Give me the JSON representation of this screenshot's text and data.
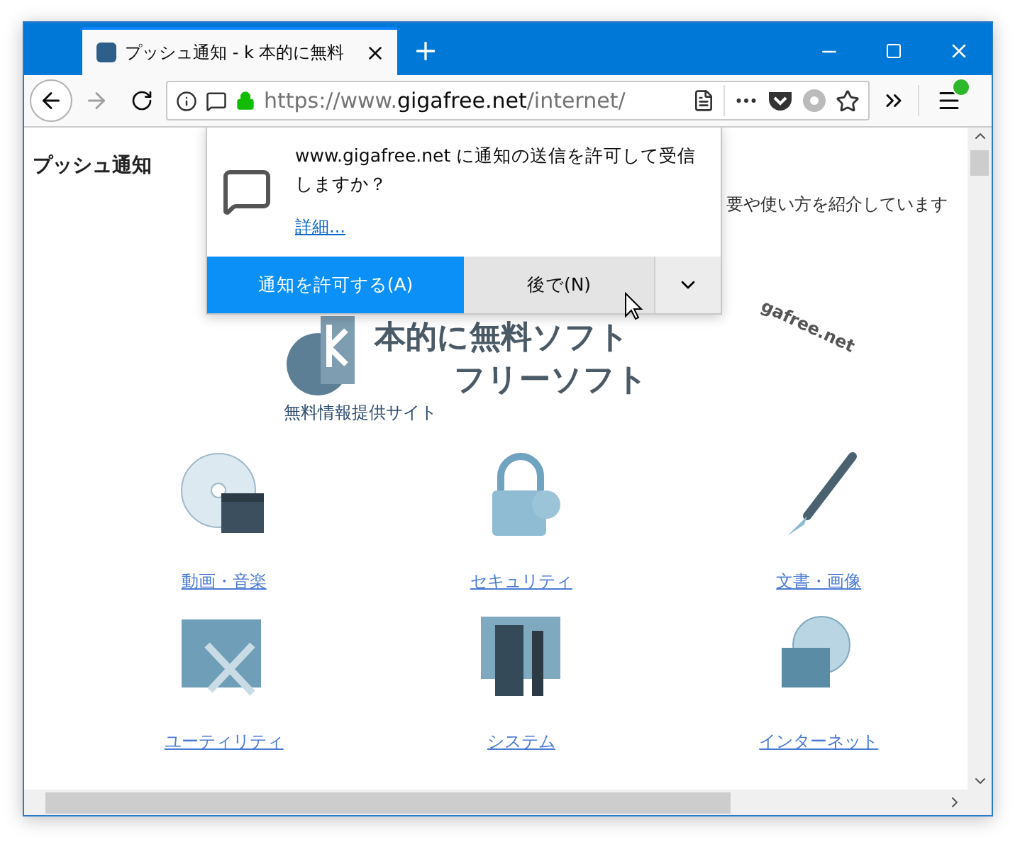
{
  "tab": {
    "title": "プッシュ通知 - k 本的に無料",
    "selected": true
  },
  "toolbar": {
    "forward_disabled": true,
    "url": {
      "scheme": "https://www.",
      "domain": "gigafree.net",
      "path": "/internet/"
    }
  },
  "page": {
    "heading": "プッシュ通知",
    "description": "要や使い方を紹介しています",
    "logo": {
      "title": "本的に無料ソフト",
      "subtitle": "フリーソフト",
      "domain": "gafree.net",
      "tagline": "無料情報提供サイト"
    },
    "categories": [
      {
        "kind": "media",
        "label": "動画・音楽"
      },
      {
        "kind": "security",
        "label": "セキュリティ"
      },
      {
        "kind": "document",
        "label": "文書・画像"
      },
      {
        "kind": "utility",
        "label": "ユーティリティ"
      },
      {
        "kind": "system",
        "label": "システム"
      },
      {
        "kind": "internet",
        "label": "インターネット"
      }
    ]
  },
  "popup": {
    "message": "www.gigafree.net に通知の送信を許可して受信しますか？",
    "link": "詳細...",
    "allow": "通知を許可する(A)",
    "later": "後で(N)"
  }
}
